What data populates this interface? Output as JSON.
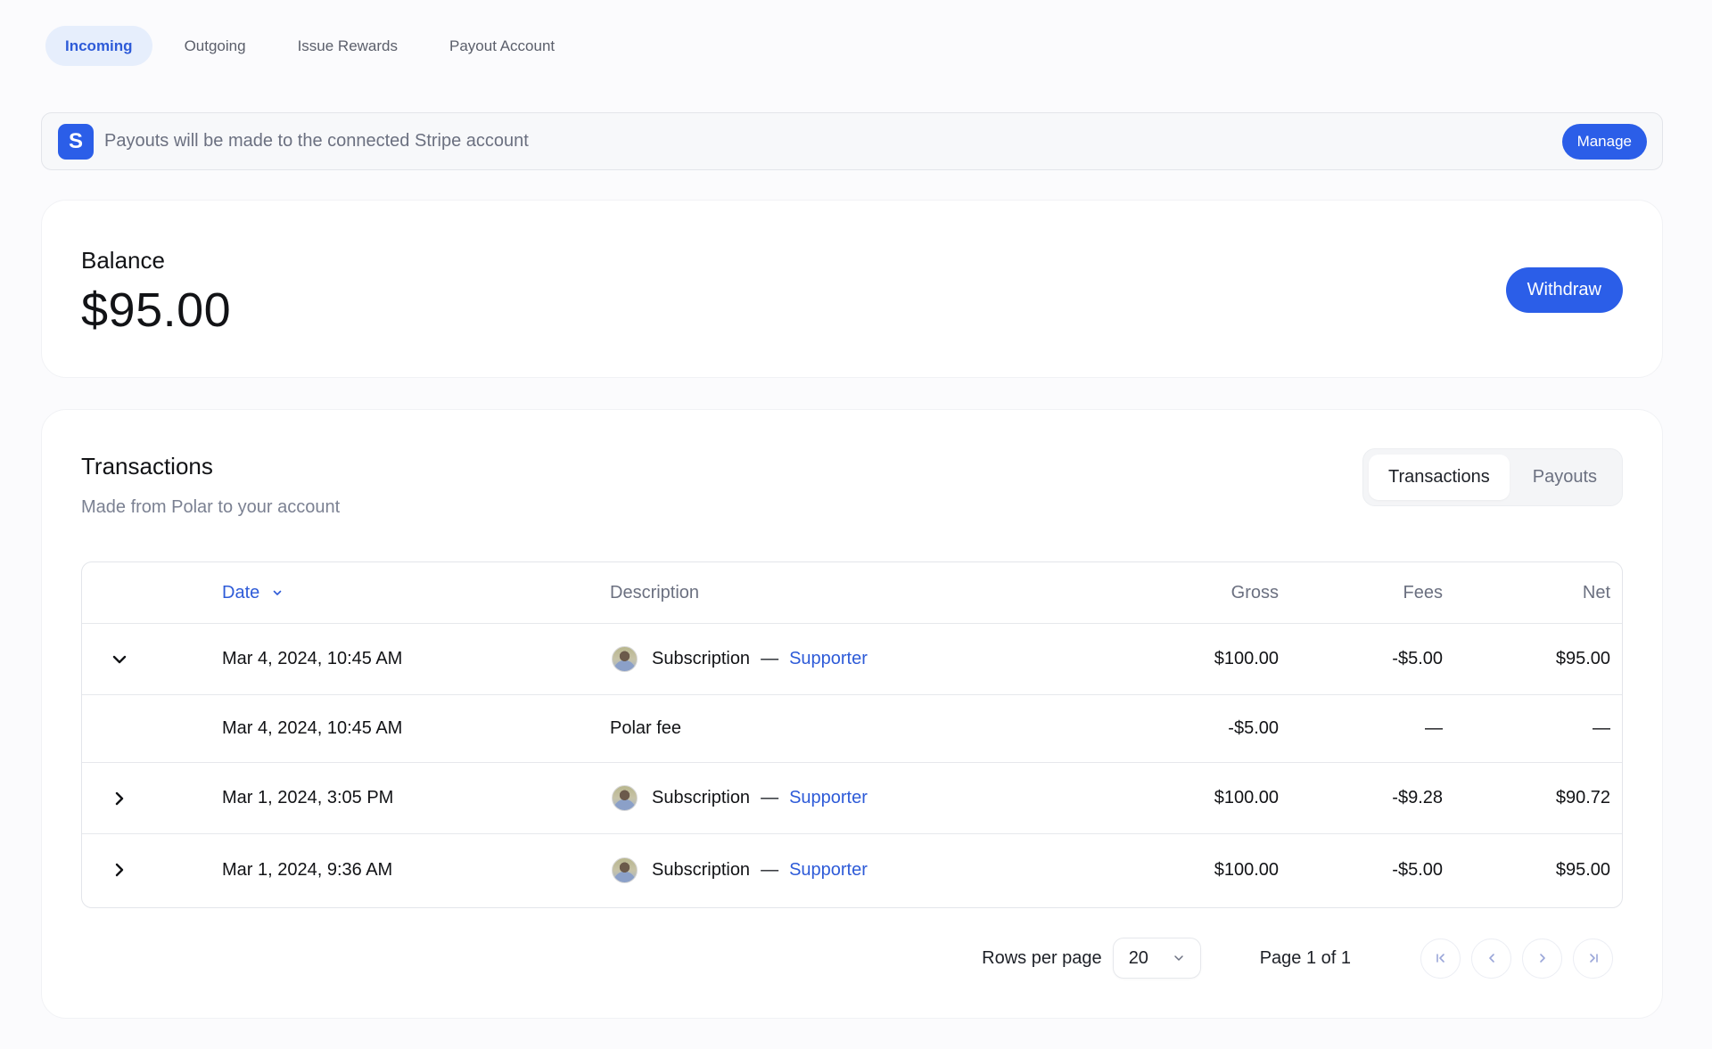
{
  "top_tabs": [
    {
      "label": "Incoming",
      "active": true
    },
    {
      "label": "Outgoing",
      "active": false
    },
    {
      "label": "Issue Rewards",
      "active": false
    },
    {
      "label": "Payout Account",
      "active": false
    }
  ],
  "banner": {
    "logo_letter": "S",
    "icon": "stripe-logo-icon",
    "text": "Payouts will be made to the connected Stripe account",
    "manage_label": "Manage"
  },
  "balance": {
    "label": "Balance",
    "value": "$95.00",
    "withdraw_label": "Withdraw"
  },
  "transactions": {
    "title": "Transactions",
    "subtitle": "Made from Polar to your account",
    "segments": [
      {
        "label": "Transactions",
        "active": true
      },
      {
        "label": "Payouts",
        "active": false
      }
    ],
    "columns": {
      "date": "Date",
      "description": "Description",
      "gross": "Gross",
      "fees": "Fees",
      "net": "Net"
    },
    "sort_icon": "chevron-down-icon",
    "rows": [
      {
        "expand": "expanded",
        "date": "Mar 4, 2024, 10:45 AM",
        "desc": "Subscription",
        "sep": "—",
        "tier": "Supporter",
        "gross": "$100.00",
        "fees": "-$5.00",
        "net": "$95.00"
      },
      {
        "expand": "none",
        "date": "Mar 4, 2024, 10:45 AM",
        "desc": "Polar fee",
        "gross": "-$5.00",
        "fees": "—",
        "net": "—"
      },
      {
        "expand": "collapsed",
        "date": "Mar 1, 2024, 3:05 PM",
        "desc": "Subscription",
        "sep": "—",
        "tier": "Supporter",
        "gross": "$100.00",
        "fees": "-$9.28",
        "net": "$90.72"
      },
      {
        "expand": "collapsed",
        "date": "Mar 1, 2024, 9:36 AM",
        "desc": "Subscription",
        "sep": "—",
        "tier": "Supporter",
        "gross": "$100.00",
        "fees": "-$5.00",
        "net": "$95.00"
      }
    ],
    "pagination": {
      "rows_per_page_label": "Rows per page",
      "rows_per_page_value": "20",
      "page_label": "Page 1 of 1"
    }
  },
  "colors": {
    "accent": "#2b5ee8",
    "link": "#2e5bd8",
    "active_tab_bg": "#e6eefc",
    "page_bg": "#fbfbfd"
  }
}
